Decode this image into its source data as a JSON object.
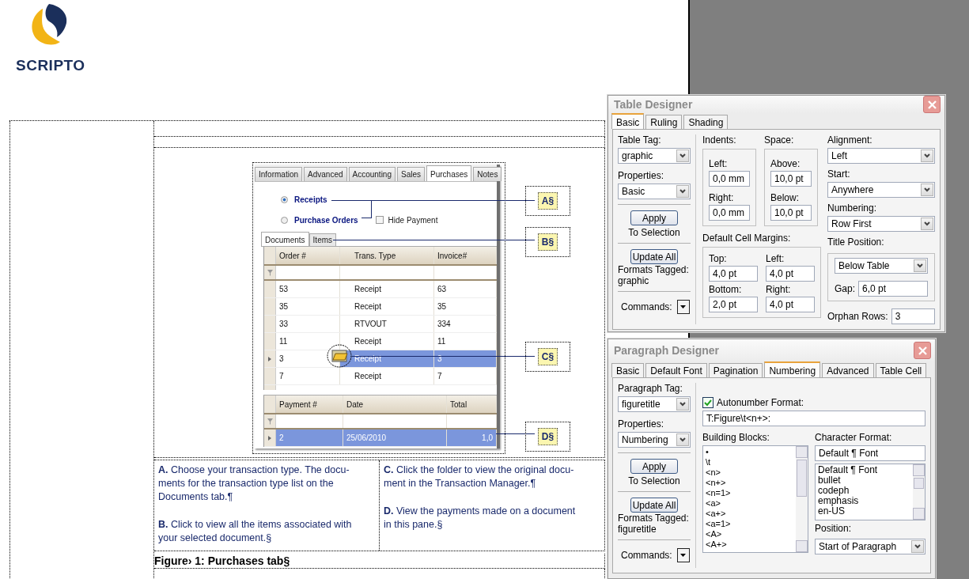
{
  "logo": {
    "wordmark": "SCRIPTO"
  },
  "figure": {
    "app_tabs": [
      {
        "label": "Information",
        "selected": false
      },
      {
        "label": "Advanced",
        "selected": false
      },
      {
        "label": "Accounting",
        "selected": false
      },
      {
        "label": "Sales",
        "selected": false
      },
      {
        "label": "Purchases",
        "selected": true
      },
      {
        "label": "Notes",
        "selected": false
      }
    ],
    "transaction_types": [
      {
        "label": "Receipts",
        "selected": true
      },
      {
        "label": "Purchase Orders",
        "selected": false
      }
    ],
    "hide_payment": {
      "label": "Hide Payment",
      "checked": false
    },
    "sub_tabs": [
      {
        "label": "Documents",
        "selected": true
      },
      {
        "label": "Items",
        "selected": false
      }
    ],
    "documents_grid": {
      "columns": [
        "Order #",
        "Trans. Type",
        "Invoice#"
      ],
      "rows": [
        {
          "cells": [
            "53",
            "Receipt",
            "63"
          ],
          "selected": false
        },
        {
          "cells": [
            "35",
            "Receipt",
            "35"
          ],
          "selected": false
        },
        {
          "cells": [
            "33",
            "RTVOUT",
            "334"
          ],
          "selected": false
        },
        {
          "cells": [
            "11",
            "Receipt",
            "11"
          ],
          "selected": false
        },
        {
          "cells": [
            "3",
            "Receipt",
            "3"
          ],
          "selected": true
        },
        {
          "cells": [
            "7",
            "Receipt",
            "7"
          ],
          "selected": false
        }
      ]
    },
    "payments_grid": {
      "columns": [
        "Payment #",
        "Date",
        "Total"
      ],
      "rows": [
        {
          "cells": [
            "2",
            "25/06/2010",
            "1,0"
          ],
          "selected": true
        }
      ]
    },
    "callouts": [
      "A§",
      "B§",
      "C§",
      "D§"
    ]
  },
  "notes": [
    [
      "**A.** Choose your transaction type. The docu-\nments for the transaction type list on the\nDocuments tab.¶",
      "**B.** Click to view all the items associated with\nyour selected document.§"
    ],
    [
      "**C.** Click the folder to view the original docu-\nment in the Transaction Manager.¶",
      "**D.** View the payments made on a document\nin this pane.§"
    ]
  ],
  "caption": "Figure› 1: Purchases tab§",
  "table_designer": {
    "title": "Table Designer",
    "tabs": [
      {
        "label": "Basic",
        "selected": true
      },
      {
        "label": "Ruling",
        "selected": false
      },
      {
        "label": "Shading",
        "selected": false
      }
    ],
    "table_tag": {
      "label": "Table Tag:",
      "value": "graphic"
    },
    "properties": {
      "label": "Properties:",
      "value": "Basic"
    },
    "apply": {
      "button": "Apply",
      "caption": "To Selection"
    },
    "update": {
      "button": "Update All",
      "caption": "Formats Tagged:",
      "tag": "graphic"
    },
    "commands": "Commands:",
    "indents": {
      "label": "Indents:",
      "fields": [
        {
          "label": "Left:",
          "value": "0,0 mm"
        },
        {
          "label": "Right:",
          "value": "0,0 mm"
        }
      ]
    },
    "space": {
      "label": "Space:",
      "fields": [
        {
          "label": "Above:",
          "value": "10,0 pt"
        },
        {
          "label": "Below:",
          "value": "10,0 pt"
        }
      ]
    },
    "cell_margins": {
      "label": "Default Cell Margins:",
      "fields": [
        {
          "label": "Top:",
          "value": "4,0 pt"
        },
        {
          "label": "Left:",
          "value": "4,0 pt"
        },
        {
          "label": "Bottom:",
          "value": "2,0 pt"
        },
        {
          "label": "Right:",
          "value": "4,0 pt"
        }
      ]
    },
    "alignment": {
      "label": "Alignment:",
      "value": "Left"
    },
    "start": {
      "label": "Start:",
      "value": "Anywhere"
    },
    "numbering": {
      "label": "Numbering:",
      "value": "Row First"
    },
    "title_position": {
      "label": "Title Position:",
      "value": "Below Table",
      "gap_label": "Gap:",
      "gap": "6,0 pt"
    },
    "orphan_rows": {
      "label": "Orphan Rows:",
      "value": "3"
    }
  },
  "paragraph_designer": {
    "title": "Paragraph Designer",
    "tabs": [
      {
        "label": "Basic",
        "selected": false
      },
      {
        "label": "Default Font",
        "selected": false
      },
      {
        "label": "Pagination",
        "selected": false
      },
      {
        "label": "Numbering",
        "selected": true
      },
      {
        "label": "Advanced",
        "selected": false
      },
      {
        "label": "Table Cell",
        "selected": false
      }
    ],
    "paragraph_tag": {
      "label": "Paragraph Tag:",
      "value": "figuretitle"
    },
    "properties": {
      "label": "Properties:",
      "value": "Numbering"
    },
    "apply": {
      "button": "Apply",
      "caption": "To Selection"
    },
    "update": {
      "button": "Update All",
      "caption": "Formats Tagged:",
      "tag": "figuretitle"
    },
    "commands": "Commands:",
    "autonumber": {
      "label": "Autonumber Format:",
      "checked": true,
      "value": "T:Figure\\t<n+>:"
    },
    "building_blocks": {
      "label": "Building Blocks:",
      "items": [
        "•",
        "\\t",
        "<n>",
        "<n+>",
        "<n=1>",
        "<a>",
        "<a+>",
        "<a=1>",
        "<A>",
        "<A+>"
      ]
    },
    "character_format": {
      "label": "Character Format:",
      "value": "Default ¶ Font",
      "items": [
        "Default ¶ Font",
        "bullet",
        "codeph",
        "emphasis",
        "en-US"
      ]
    },
    "position": {
      "label": "Position:",
      "value": "Start of Paragraph"
    }
  }
}
